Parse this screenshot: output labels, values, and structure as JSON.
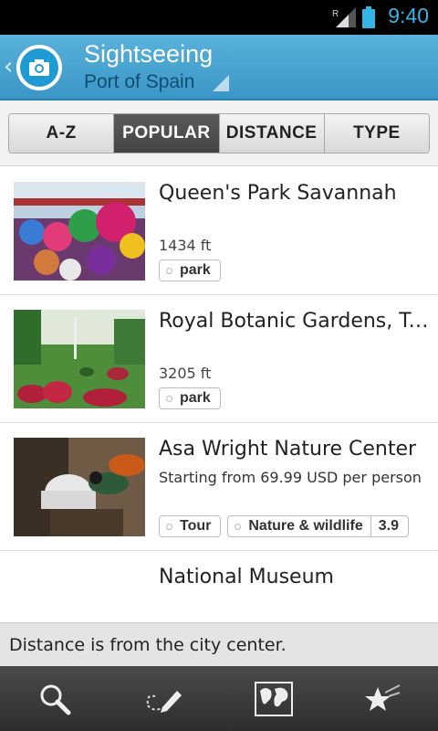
{
  "status_bar": {
    "time": "9:40",
    "network_letter": "R",
    "accent_color": "#33b5e5",
    "icons": [
      "signal-icon",
      "battery-icon"
    ]
  },
  "header": {
    "title": "Sightseeing",
    "subtitle": "Port of Spain",
    "icons": [
      "back-chevron-icon",
      "camera-icon"
    ]
  },
  "tabs": [
    {
      "label": "A-Z",
      "active": false
    },
    {
      "label": "POPULAR",
      "active": true
    },
    {
      "label": "DISTANCE",
      "active": false
    },
    {
      "label": "TYPE",
      "active": false
    }
  ],
  "list": [
    {
      "title": "Queen's Park Savannah",
      "subtitle": "",
      "distance": "1434 ft",
      "tags": [
        {
          "label": "park"
        }
      ]
    },
    {
      "title": "Royal Botanic Gardens, Trinidad",
      "subtitle": "",
      "distance": "3205 ft",
      "tags": [
        {
          "label": "park"
        }
      ]
    },
    {
      "title": "Asa Wright Nature Center",
      "subtitle": "Starting from 69.99 USD per person",
      "distance": "",
      "tags": [
        {
          "label": "Tour"
        },
        {
          "label": "Nature & wildlife",
          "rating": "3.9"
        }
      ]
    },
    {
      "title": "National Museum",
      "subtitle": "",
      "distance": "",
      "tags": []
    }
  ],
  "note": "Distance is from the city center.",
  "bottom_bar": {
    "icons": [
      "search-icon",
      "plan-icon",
      "map-icon",
      "favorites-icon"
    ]
  },
  "colors": {
    "header_top": "#5ab2db",
    "header_bottom": "#3a96c6",
    "subtitle": "#0f4d73",
    "tab_active": "#4a4a4a"
  }
}
